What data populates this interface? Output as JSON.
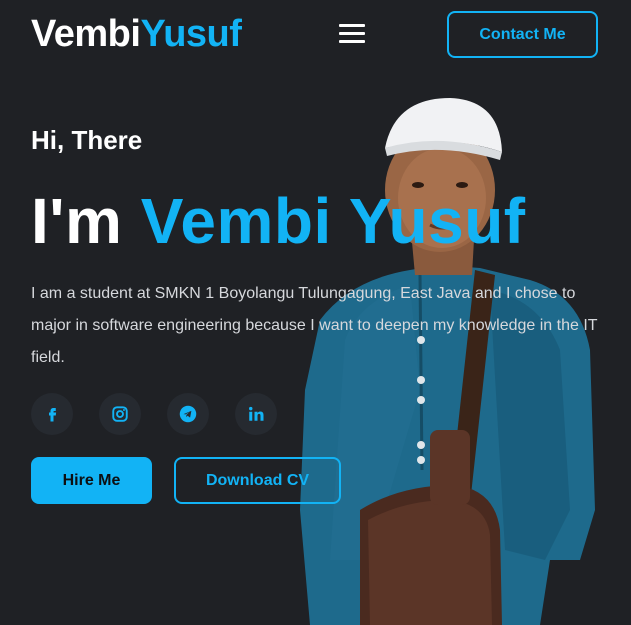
{
  "header": {
    "logo_first": "Vembi",
    "logo_second": "Yusuf",
    "menu_icon": "hamburger-icon",
    "contact_label": "Contact Me"
  },
  "hero": {
    "greeting": "Hi, There",
    "headline_prefix": "I'm",
    "headline_name": "Vembi Yusuf",
    "description": "I am a student at SMKN 1 Boyolangu Tulungagung, East Java and I chose to major in software engineering because I want to deepen my knowledge in the IT field.",
    "portrait_icon": "profile-photo"
  },
  "socials": [
    {
      "icon": "facebook-icon"
    },
    {
      "icon": "instagram-icon"
    },
    {
      "icon": "telegram-icon"
    },
    {
      "icon": "linkedin-icon"
    }
  ],
  "actions": {
    "hire_label": "Hire Me",
    "cv_label": "Download CV"
  },
  "colors": {
    "background": "#1f2125",
    "accent": "#12b3f5",
    "text": "#ffffff"
  }
}
